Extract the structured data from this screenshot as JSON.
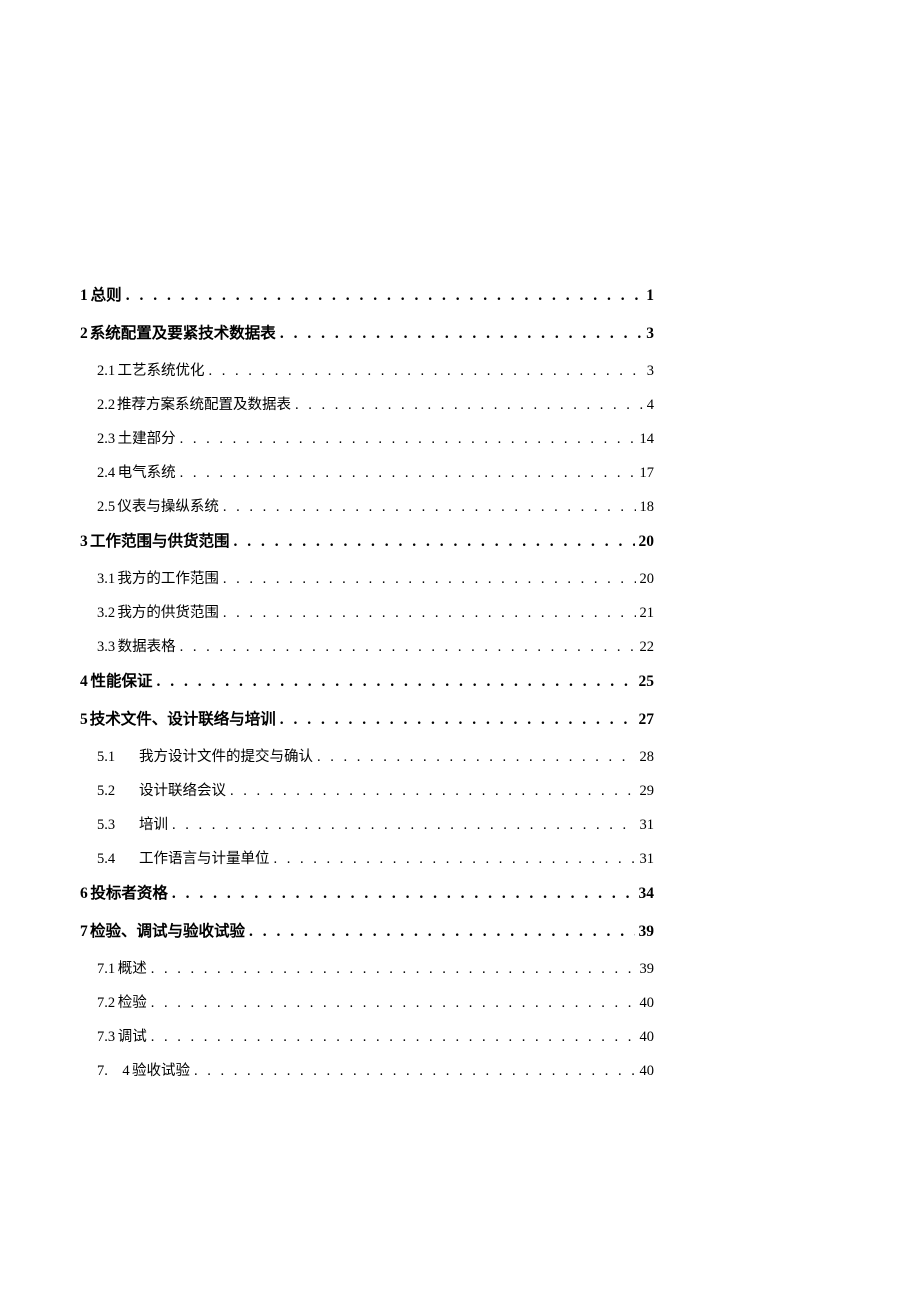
{
  "toc": [
    {
      "type": "main",
      "num": "1",
      "title": "总则",
      "page": "1"
    },
    {
      "type": "main",
      "num": "2",
      "title": "系统配置及要紧技术数据表",
      "page": "3"
    },
    {
      "type": "sub",
      "num": "2.1",
      "title": "工艺系统优化",
      "page": "3"
    },
    {
      "type": "sub",
      "num": "2.2",
      "title": "推荐方案系统配置及数据表",
      "page": "4"
    },
    {
      "type": "sub",
      "num": "2.3",
      "title": "土建部分",
      "page": "14"
    },
    {
      "type": "sub",
      "num": "2.4",
      "title": "电气系统",
      "page": "17"
    },
    {
      "type": "sub",
      "num": "2.5",
      "title": "仪表与操纵系统",
      "page": "18"
    },
    {
      "type": "main",
      "num": "3",
      "title": "工作范围与供货范围",
      "page": "20"
    },
    {
      "type": "sub",
      "num": "3.1",
      "title": "我方的工作范围",
      "page": "20"
    },
    {
      "type": "sub",
      "num": "3.2",
      "title": "我方的供货范围",
      "page": "21"
    },
    {
      "type": "sub",
      "num": "3.3",
      "title": "数据表格",
      "page": "22"
    },
    {
      "type": "main",
      "num": "4",
      "title": "性能保证",
      "page": "25"
    },
    {
      "type": "main",
      "num": "5",
      "title": "技术文件、设计联络与培训",
      "page": "27"
    },
    {
      "type": "sub2",
      "num": "5.1",
      "title": "我方设计文件的提交与确认",
      "page": "28"
    },
    {
      "type": "sub2",
      "num": "5.2",
      "title": "设计联络会议",
      "page": "29"
    },
    {
      "type": "sub2",
      "num": "5.3",
      "title": "培训",
      "page": "31"
    },
    {
      "type": "sub2",
      "num": "5.4",
      "title": "工作语言与计量单位",
      "page": "31"
    },
    {
      "type": "main",
      "num": "6",
      "title": "投标者资格",
      "page": "34"
    },
    {
      "type": "main",
      "num": "7",
      "title": "检验、调试与验收试验",
      "page": "39"
    },
    {
      "type": "sub",
      "num": "7.1",
      "title": "概述",
      "page": "39"
    },
    {
      "type": "sub",
      "num": "7.2",
      "title": "检验",
      "page": "40"
    },
    {
      "type": "sub",
      "num": "7.3",
      "title": "调试",
      "page": "40"
    },
    {
      "type": "sub",
      "num": "7.　4",
      "title": "验收试验",
      "page": "40"
    }
  ]
}
